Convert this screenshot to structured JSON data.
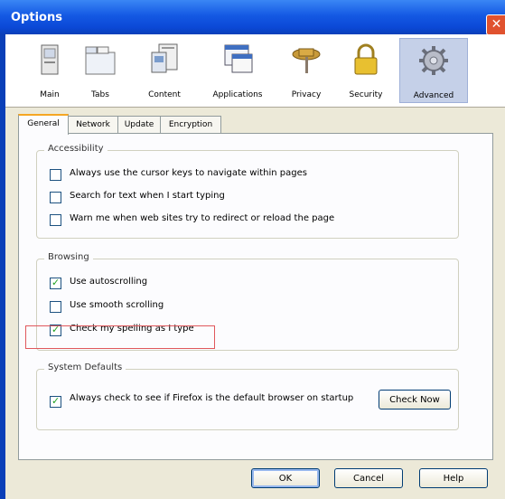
{
  "window": {
    "title": "Options",
    "close_glyph": "✕"
  },
  "toolbar": {
    "items": [
      {
        "label": "Main",
        "icon": "main-icon"
      },
      {
        "label": "Tabs",
        "icon": "tabs-icon"
      },
      {
        "label": "Content",
        "icon": "content-icon"
      },
      {
        "label": "Applications",
        "icon": "applications-icon"
      },
      {
        "label": "Privacy",
        "icon": "privacy-icon"
      },
      {
        "label": "Security",
        "icon": "security-icon"
      },
      {
        "label": "Advanced",
        "icon": "advanced-icon",
        "selected": true
      }
    ]
  },
  "tabs": [
    {
      "label": "General",
      "active": true
    },
    {
      "label": "Network"
    },
    {
      "label": "Update"
    },
    {
      "label": "Encryption"
    }
  ],
  "accessibility": {
    "title": "Accessibility",
    "options": [
      {
        "label": "Always use the cursor keys to navigate within pages",
        "checked": false
      },
      {
        "label": "Search for text when I start typing",
        "checked": false
      },
      {
        "label": "Warn me when web sites try to redirect or reload the page",
        "checked": false
      }
    ]
  },
  "browsing": {
    "title": "Browsing",
    "options": [
      {
        "label": "Use autoscrolling",
        "checked": true
      },
      {
        "label": "Use smooth scrolling",
        "checked": false
      },
      {
        "label": "Check my spelling as I type",
        "checked": true
      }
    ]
  },
  "system_defaults": {
    "title": "System Defaults",
    "option_label": "Always check to see if Firefox is the default browser on startup",
    "checked": true,
    "check_now_label": "Check Now"
  },
  "buttons": {
    "ok": "OK",
    "cancel": "Cancel",
    "help": "Help"
  },
  "colors": {
    "title_bar": "#0a3fb8",
    "dialog_bg": "#ece9d8",
    "highlight_box": "#e0585c",
    "check": "#21a121"
  }
}
